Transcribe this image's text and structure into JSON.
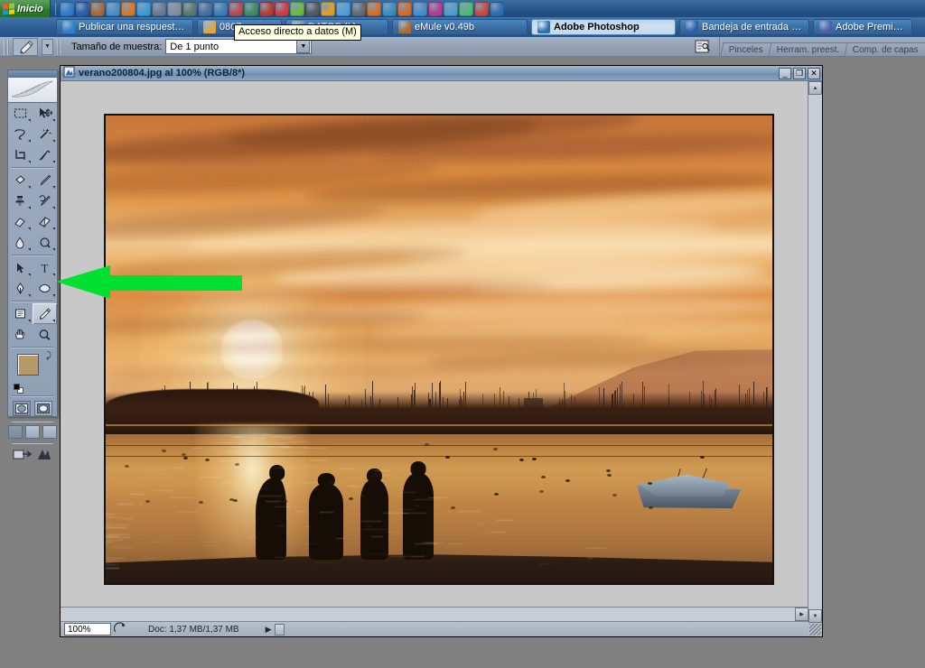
{
  "taskbar": {
    "start_label": "Inicio",
    "quicklaunch_icons": [
      "internet-explorer-icon",
      "outlook-icon",
      "emule-icon",
      "shortcut-blue-icon",
      "vlc-icon",
      "messenger-icon",
      "hardware-icon",
      "drive-icon",
      "network-drive-icon",
      "network-drive2-icon",
      "phone-icon",
      "pen-icon",
      "pencil-icon",
      "acrobat-icon",
      "opera-icon",
      "frog-icon",
      "camera-icon",
      "clock-icon",
      "msn-icon",
      "at-icon",
      "player-icon",
      "globe-icon",
      "firefox-icon",
      "search-icon",
      "colors-icon",
      "paint-icon",
      "update-icon",
      "calendar-icon",
      "wave-icon"
    ],
    "buttons": [
      {
        "label": "Publicar una respuesta - ...",
        "icon": "internet-explorer-icon",
        "active": false
      },
      {
        "label": "0807ve",
        "icon": "folder-icon",
        "active": false
      },
      {
        "label": "DATOS (I:)",
        "icon": "drive-icon",
        "active": false
      },
      {
        "label": "eMule v0.49b",
        "icon": "emule-icon",
        "active": false
      },
      {
        "label": "Adobe Photoshop",
        "icon": "photoshop-icon",
        "active": true
      },
      {
        "label": "Bandeja de entrada - Outl...",
        "icon": "outlook-icon",
        "active": false
      },
      {
        "label": "Adobe Premiere",
        "icon": "premiere-icon",
        "active": false
      }
    ],
    "tooltip": "Acceso directo a datos (M)"
  },
  "options_bar": {
    "tool_icon": "eyedropper-icon",
    "sample_size_label": "Tamaño de muestra:",
    "sample_size_value": "De 1 punto",
    "dock_icon": "palette-well-icon",
    "palette_tabs": [
      "Pinceles",
      "Herram. preest.",
      "Comp. de capas"
    ]
  },
  "toolbox": {
    "logo": "photoshop-feather-logo",
    "tools": [
      {
        "name": "marquee-tool",
        "glyph": "▭"
      },
      {
        "name": "move-tool",
        "glyph": "✥"
      },
      {
        "name": "lasso-tool",
        "glyph": "❥"
      },
      {
        "name": "magic-wand-tool",
        "glyph": "✳"
      },
      {
        "name": "crop-tool",
        "glyph": "⌗"
      },
      {
        "name": "slice-tool",
        "glyph": "✂"
      },
      {
        "name": "healing-brush-tool",
        "glyph": "◇"
      },
      {
        "name": "brush-tool",
        "glyph": "✎"
      },
      {
        "name": "clone-stamp-tool",
        "glyph": "⚲"
      },
      {
        "name": "history-brush-tool",
        "glyph": "✍"
      },
      {
        "name": "eraser-tool",
        "glyph": "▱"
      },
      {
        "name": "gradient-tool",
        "glyph": "◧"
      },
      {
        "name": "blur-tool",
        "glyph": "💧"
      },
      {
        "name": "dodge-tool",
        "glyph": "◐"
      },
      {
        "name": "path-selection-tool",
        "glyph": "➤"
      },
      {
        "name": "type-tool",
        "glyph": "T"
      },
      {
        "name": "pen-tool",
        "glyph": "✒"
      },
      {
        "name": "shape-tool",
        "glyph": "⬭"
      },
      {
        "name": "notes-tool",
        "glyph": "🗒"
      },
      {
        "name": "eyedropper-tool",
        "glyph": "⚲"
      },
      {
        "name": "hand-tool",
        "glyph": "✋"
      },
      {
        "name": "zoom-tool",
        "glyph": "🔍"
      }
    ],
    "selected_tool": "eyedropper-tool",
    "foreground_color": "#b49b69",
    "background_color": "#000000",
    "quickmask_modes": [
      "standard-mode",
      "quick-mask-mode"
    ],
    "screen_modes": [
      "standard-screen-mode",
      "full-screen-menubar-mode",
      "full-screen-mode"
    ],
    "jump_to": [
      "jump-to-imageready",
      "jump-to-other"
    ]
  },
  "document": {
    "title": "verano200804.jpg al 100% (RGB/8*)",
    "icon": "photoshop-document-icon",
    "window_buttons": [
      "minimize",
      "maximize",
      "close"
    ],
    "status": {
      "zoom": "100%",
      "doc_info": "Doc: 1,37 MB/1,37 MB"
    }
  },
  "annotation": {
    "arrow_color": "#00e033",
    "arrow_direction": "left",
    "points_to": "eyedropper-tool"
  },
  "photo": {
    "description": "Sunset over a lagoon: orange streaked sky, bright sun low on horizon, distant masts and mountain, four people silhouetted on the beach, covered boat on the right"
  }
}
